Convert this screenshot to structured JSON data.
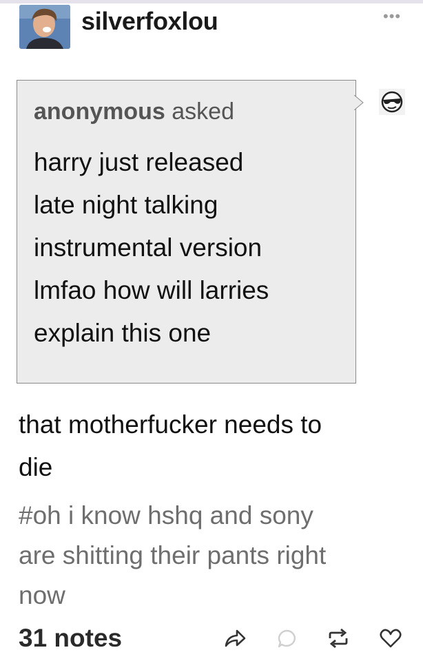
{
  "post": {
    "blog_name": "silverfoxlou",
    "more_label": "•••",
    "ask": {
      "asker": "anonymous",
      "asked_label": "asked",
      "question_lines": [
        "harry just released",
        "late night talking",
        "instrumental version",
        "lmfao how will larries",
        "explain this one"
      ]
    },
    "answer_lines": [
      "that motherfucker needs to",
      "die"
    ],
    "tag_lines": [
      "#oh i know hshq and sony",
      "are shitting their pants right",
      "now"
    ],
    "notes": "31 notes"
  },
  "icons": {
    "avatar": "profile-photo",
    "anon_avatar": "sunglasses-face-icon",
    "share": "share-arrow-icon",
    "reply": "reply-bubble-icon",
    "reblog": "reblog-icon",
    "like": "heart-icon"
  },
  "colors": {
    "ask_bg": "#ececec",
    "ask_border": "#8a8a8a",
    "tag_text": "#6e6e6e",
    "top_bar": "#e6e2ec"
  }
}
